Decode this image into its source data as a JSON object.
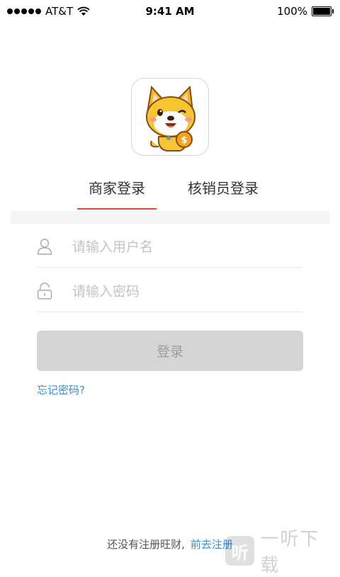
{
  "status_bar": {
    "carrier": "AT&T",
    "time": "9:41 AM",
    "battery": "100%"
  },
  "app": {
    "icon": "shiba-dog-coin-icon"
  },
  "tabs": [
    {
      "label": "商家登录",
      "active": true
    },
    {
      "label": "核销员登录",
      "active": false
    }
  ],
  "form": {
    "username_placeholder": "请输入用户名",
    "username_value": "",
    "password_placeholder": "请输入密码",
    "password_value": "",
    "login_label": "登录",
    "forgot_label": "忘记密码?"
  },
  "footer": {
    "prompt": "还没有注册旺财,",
    "register_link": "前去注册"
  },
  "watermark": {
    "logo_char": "听",
    "text": "一听下载"
  },
  "colors": {
    "accent": "#e64340",
    "link": "#3a8ed8",
    "button_disabled": "#d5d5d5"
  }
}
